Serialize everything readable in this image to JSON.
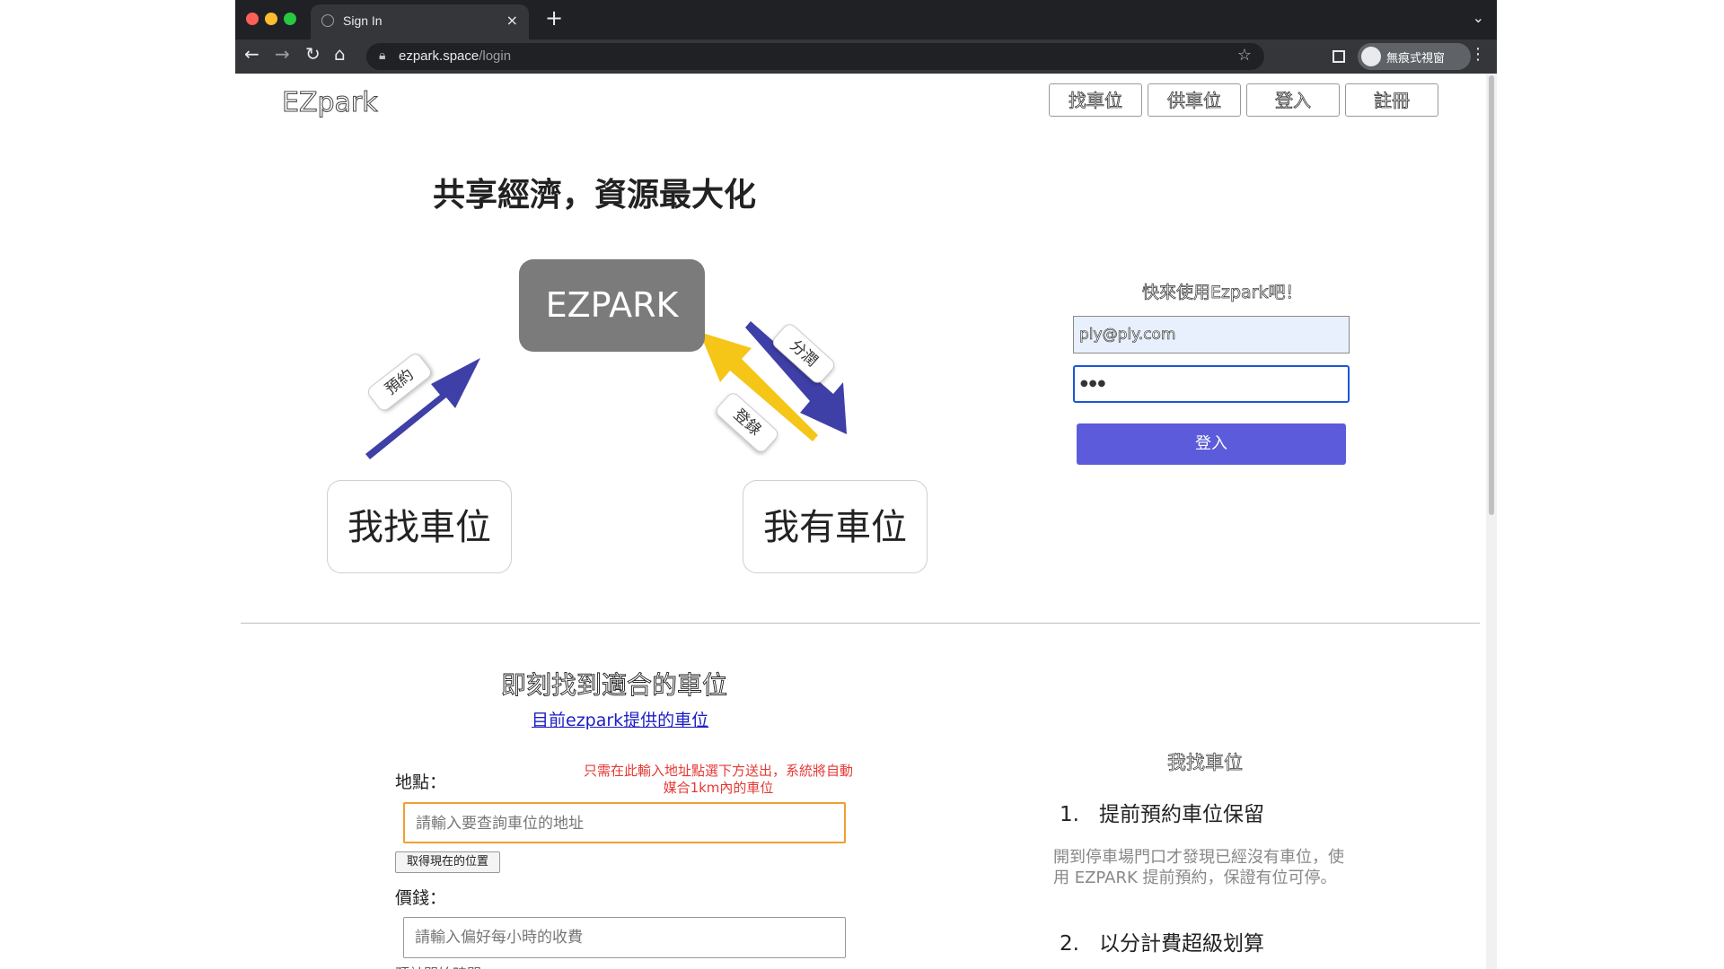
{
  "browser": {
    "tab_title": "Sign In",
    "tab_close": "×",
    "new_tab": "+",
    "tab_menu": "⌄",
    "url_host": "ezpark.space",
    "url_path": "/login",
    "incognito_label": "無痕式視窗",
    "traffic_lights": [
      "#ff5f57",
      "#febc2e",
      "#28c840"
    ]
  },
  "header": {
    "logo": "EZpark",
    "nav": [
      "找車位",
      "供車位",
      "登入",
      "註冊"
    ]
  },
  "hero": {
    "title": "共享經濟，資源最大化",
    "center_box": "EZPARK",
    "left_box": "我找車位",
    "right_box": "我有車位",
    "tags": {
      "reserve": "預約",
      "share": "分潤",
      "register": "登錄"
    },
    "arrow_colors": {
      "blue": "#3f3fa8",
      "yellow": "#f5c518"
    }
  },
  "login": {
    "prompt": "快來使用Ezpark吧！",
    "email_value": "ply@ply.com",
    "password_value": "●●●",
    "button": "登入",
    "button_color": "#5b5bdb"
  },
  "search": {
    "title": "即刻找到適合的車位",
    "link": "目前ezpark提供的車位",
    "location_label": "地點：",
    "hint": "只需在此輸入地址點選下方送出，系統將自動媒合1km內的車位",
    "address_placeholder": "請輸入要查詢車位的地址",
    "current_location_button": "取得現在的位置",
    "price_label": "價錢：",
    "price_placeholder": "請輸入偏好每小時的收費",
    "next_label": "預計開始時間："
  },
  "features": {
    "title": "我找車位",
    "items": [
      {
        "num": "1.",
        "title": "提前預約車位保留",
        "desc": "開到停車場門口才發現已經沒有車位，使用 EZPARK 提前預約，保證有位可停。"
      },
      {
        "num": "2.",
        "title": "以分計費超級划算"
      }
    ]
  }
}
